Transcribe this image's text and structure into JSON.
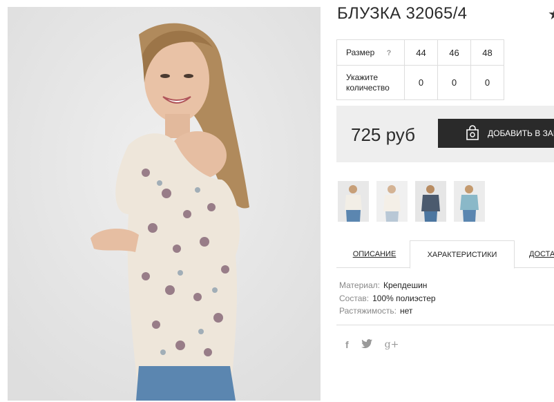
{
  "product": {
    "title": "БЛУЗКА 32065/4",
    "favorite_icon": "star-icon"
  },
  "sizes": {
    "size_label": "Размер",
    "help_label": "?",
    "quantity_label_line1": "Укажите",
    "quantity_label_line2": "количество",
    "columns": [
      {
        "size": "44",
        "qty": "0"
      },
      {
        "size": "46",
        "qty": "0"
      },
      {
        "size": "48",
        "qty": "0"
      }
    ]
  },
  "purchase": {
    "price": "725 руб",
    "add_to_cart_label": "ДОБАВИТЬ В ЗАКАЗ",
    "cart_icon": "shopping-bag-icon",
    "button_color": "#2a2a2a"
  },
  "thumbnails": {
    "count": 4,
    "icon": "product-thumbnail"
  },
  "tabs": [
    {
      "label": "ОПИСАНИЕ",
      "active": false
    },
    {
      "label": "ХАРАКТЕРИСТИКИ",
      "active": true
    },
    {
      "label": "ДОСТАВКА",
      "active": false
    }
  ],
  "specs": [
    {
      "key": "Материал:",
      "value": "Крепдешин"
    },
    {
      "key": "Состав:",
      "value": "100% полиэстер"
    },
    {
      "key": "Растяжимость:",
      "value": "нет"
    }
  ],
  "social": {
    "facebook": "f",
    "twitter_icon": "twitter-bird-icon",
    "googleplus": "g+"
  }
}
